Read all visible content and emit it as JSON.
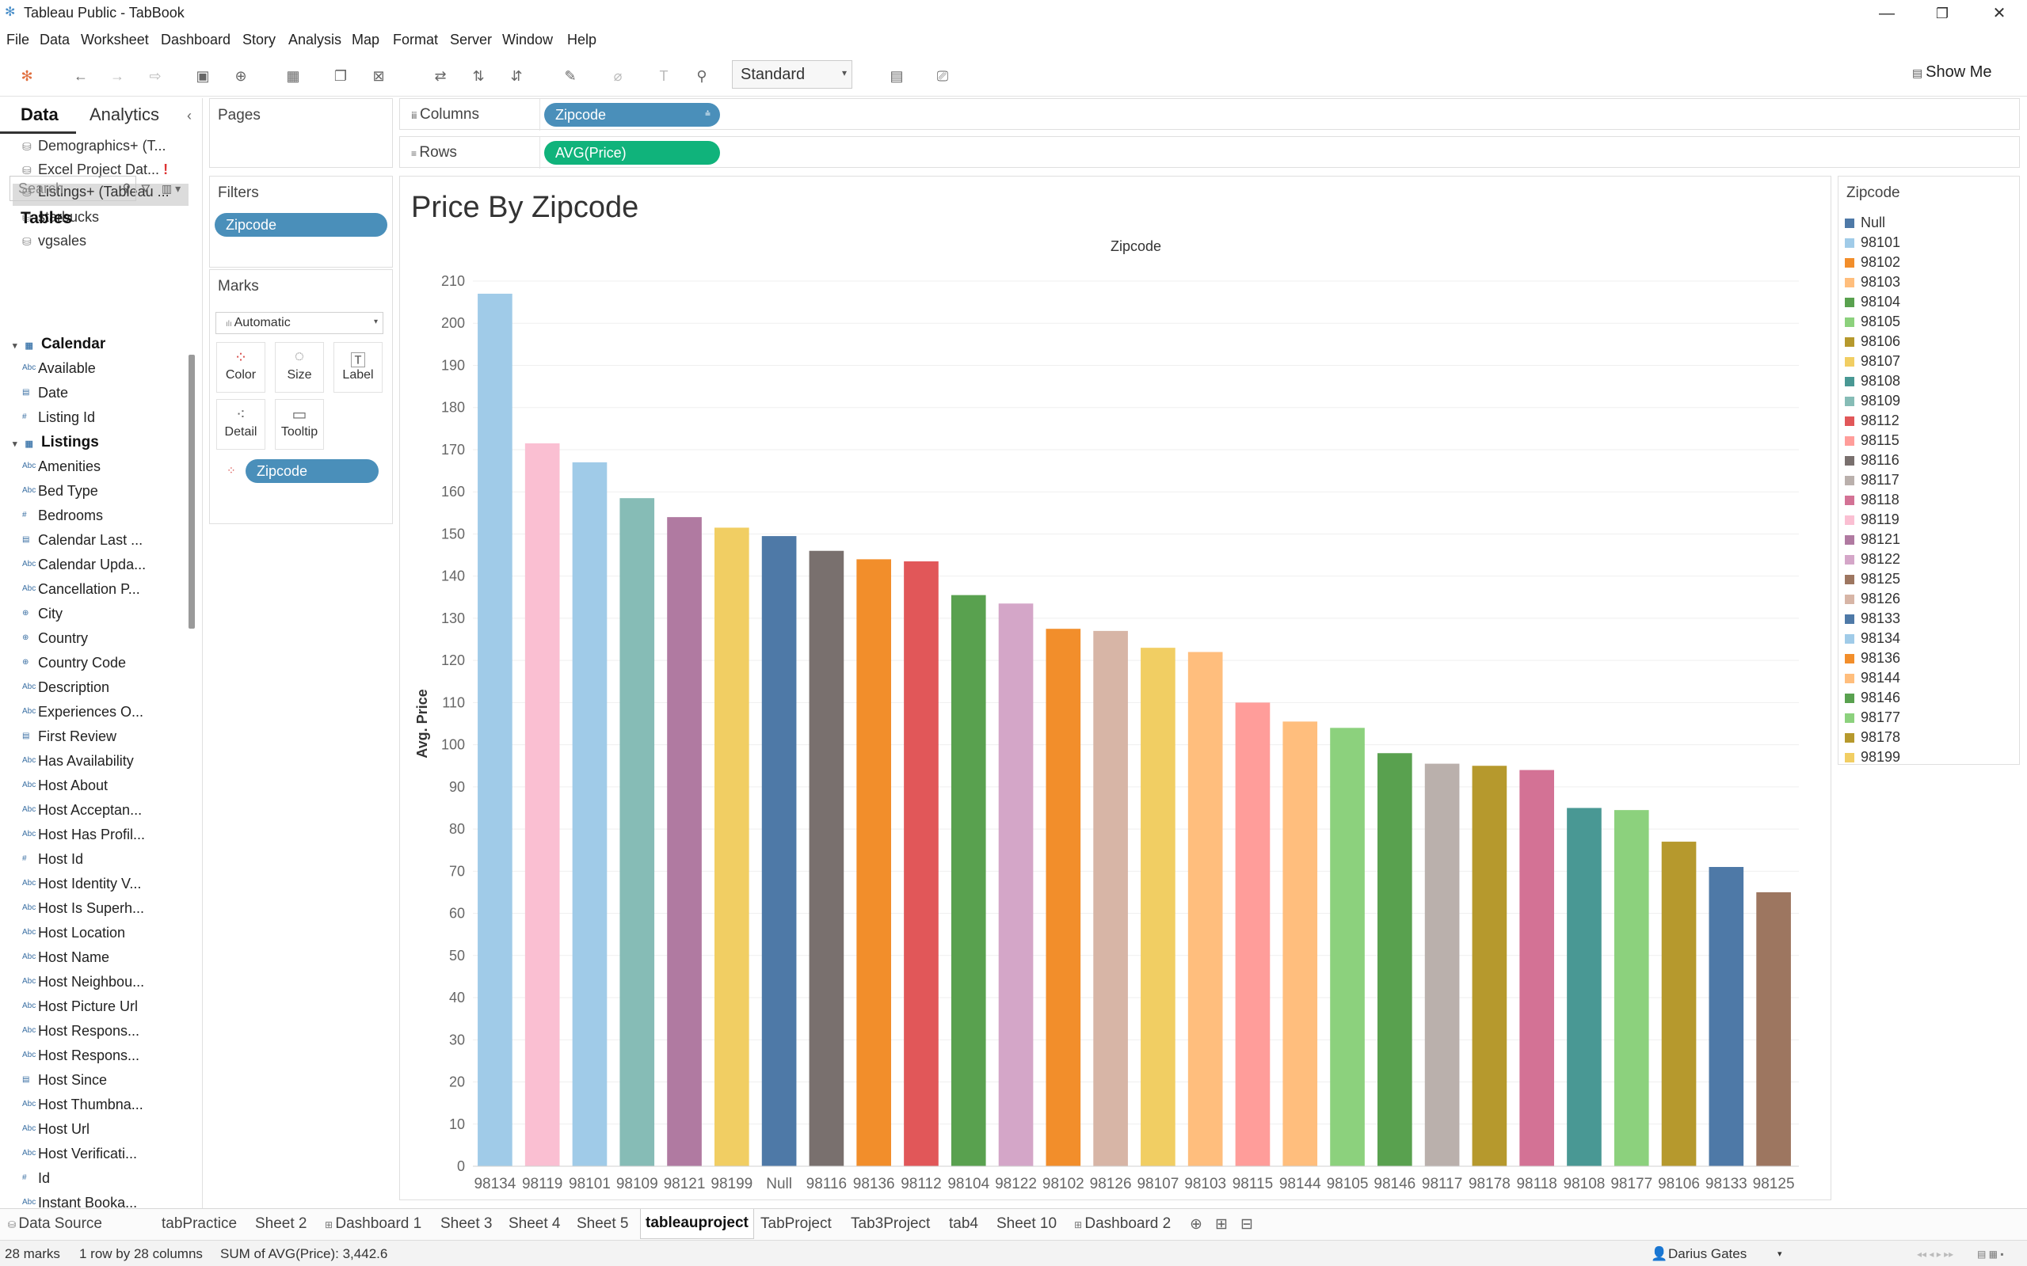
{
  "window": {
    "title": "Tableau Public - TabBook",
    "minimize": "—",
    "maximize": "❐",
    "close": "✕"
  },
  "menu": [
    "File",
    "Data",
    "Worksheet",
    "Dashboard",
    "Story",
    "Analysis",
    "Map",
    "Format",
    "Server",
    "Window",
    "Help"
  ],
  "toolbar": {
    "fit_select": "Standard",
    "show_me": "Show Me"
  },
  "data_pane": {
    "tab_data": "Data",
    "tab_analytics": "Analytics",
    "data_sources": [
      "Demographics+ (T...",
      "Excel Project Dat...",
      "Listings+ (Tableau ...",
      "starbucks",
      "vgsales"
    ],
    "search_placeholder": "Search",
    "tables_heading": "Tables",
    "tables": [
      {
        "name": "Calendar",
        "fields": [
          "Available",
          "Date",
          "Listing Id"
        ]
      },
      {
        "name": "Listings",
        "fields": [
          "Amenities",
          "Bed Type",
          "Bedrooms",
          "Calendar Last ...",
          "Calendar Upda...",
          "Cancellation P...",
          "City",
          "Country",
          "Country Code",
          "Description",
          "Experiences O...",
          "First Review",
          "Has Availability",
          "Host About",
          "Host Acceptan...",
          "Host Has Profil...",
          "Host Id",
          "Host Identity V...",
          "Host Is Superh...",
          "Host Location",
          "Host Name",
          "Host Neighbou...",
          "Host Picture Url",
          "Host Respons...",
          "Host Respons...",
          "Host Since",
          "Host Thumbna...",
          "Host Url",
          "Host Verificati...",
          "Id",
          "Instant Booka..."
        ]
      }
    ],
    "field_types": {
      "Available": "Abc",
      "Date": "▤",
      "Listing Id": "#",
      "Amenities": "Abc",
      "Bed Type": "Abc",
      "Bedrooms": "#",
      "Calendar Last ...": "▤",
      "Calendar Upda...": "Abc",
      "Cancellation P...": "Abc",
      "City": "⊕",
      "Country": "⊕",
      "Country Code": "⊕",
      "Description": "Abc",
      "Experiences O...": "Abc",
      "First Review": "▤",
      "Has Availability": "Abc",
      "Host About": "Abc",
      "Host Acceptan...": "Abc",
      "Host Has Profil...": "Abc",
      "Host Id": "#",
      "Host Identity V...": "Abc",
      "Host Is Superh...": "Abc",
      "Host Location": "Abc",
      "Host Name": "Abc",
      "Host Neighbou...": "Abc",
      "Host Picture Url": "Abc",
      "Host Respons...": "Abc",
      "Host Since": "▤",
      "Host Thumbna...": "Abc",
      "Host Url": "Abc",
      "Host Verificati...": "Abc",
      "Id": "#",
      "Instant Booka...": "Abc"
    }
  },
  "cards": {
    "pages": "Pages",
    "filters": "Filters",
    "filter_pill": "Zipcode",
    "marks": "Marks",
    "marks_type": "Automatic",
    "mark_buttons": [
      "Color",
      "Size",
      "Label",
      "Detail",
      "Tooltip"
    ],
    "marks_pill": "Zipcode"
  },
  "shelves": {
    "columns_label": "Columns",
    "columns_pill": "Zipcode",
    "rows_label": "Rows",
    "rows_pill": "AVG(Price)"
  },
  "view": {
    "title": "Price By Zipcode"
  },
  "chart_data": {
    "type": "bar",
    "title": "Price By Zipcode",
    "header": "Zipcode",
    "ylabel": "Avg. Price",
    "ylim": [
      0,
      210
    ],
    "yticks": [
      0,
      10,
      20,
      30,
      40,
      50,
      60,
      70,
      80,
      90,
      100,
      110,
      120,
      130,
      140,
      150,
      160,
      170,
      180,
      190,
      200,
      210
    ],
    "grid": true,
    "categories": [
      "98134",
      "98119",
      "98101",
      "98109",
      "98121",
      "98199",
      "Null",
      "98116",
      "98136",
      "98112",
      "98104",
      "98122",
      "98102",
      "98126",
      "98107",
      "98103",
      "98115",
      "98144",
      "98105",
      "98146",
      "98117",
      "98178",
      "98118",
      "98108",
      "98177",
      "98106",
      "98133",
      "98125"
    ],
    "values": [
      207,
      171.5,
      167,
      158.5,
      154,
      151.5,
      149.5,
      146,
      144,
      143.5,
      135.5,
      133.5,
      127.5,
      127,
      123,
      122,
      110,
      105.5,
      104,
      98,
      95.5,
      95,
      94,
      85,
      84.5,
      77,
      71,
      65
    ],
    "colors": {
      "Null": "#4e79a7",
      "98101": "#a0cbe8",
      "98102": "#f28e2b",
      "98103": "#ffbe7d",
      "98104": "#59a14f",
      "98105": "#8cd17d",
      "98106": "#b6992d",
      "98107": "#f1ce63",
      "98108": "#499894",
      "98109": "#86bcb6",
      "98112": "#e15759",
      "98115": "#ff9d9a",
      "98116": "#79706e",
      "98117": "#bab0ac",
      "98118": "#d37295",
      "98119": "#fabfd2",
      "98121": "#b07aa1",
      "98122": "#d4a6c8",
      "98125": "#9d7660",
      "98126": "#d7b5a6",
      "98133": "#4e79a7",
      "98134": "#a0cbe8",
      "98136": "#f28e2b",
      "98144": "#ffbe7d",
      "98146": "#59a14f",
      "98177": "#8cd17d",
      "98178": "#b6992d",
      "98199": "#f1ce63"
    }
  },
  "legend": {
    "title": "Zipcode",
    "items": [
      "Null",
      "98101",
      "98102",
      "98103",
      "98104",
      "98105",
      "98106",
      "98107",
      "98108",
      "98109",
      "98112",
      "98115",
      "98116",
      "98117",
      "98118",
      "98119",
      "98121",
      "98122",
      "98125",
      "98126",
      "98133",
      "98134",
      "98136",
      "98144",
      "98146",
      "98177",
      "98178",
      "98199"
    ]
  },
  "sheet_tabs": [
    "Data Source",
    "tabPractice",
    "Sheet 2",
    "Dashboard 1",
    "Sheet 3",
    "Sheet 4",
    "Sheet 5",
    "tableauproject",
    "TabProject",
    "Tab3Project",
    "tab4",
    "Sheet 10",
    "Dashboard 2"
  ],
  "active_tab": "tableauproject",
  "status": {
    "marks": "28 marks",
    "rows_cols": "1 row by 28 columns",
    "sum": "SUM of AVG(Price): 3,442.6",
    "user": "Darius Gates"
  }
}
